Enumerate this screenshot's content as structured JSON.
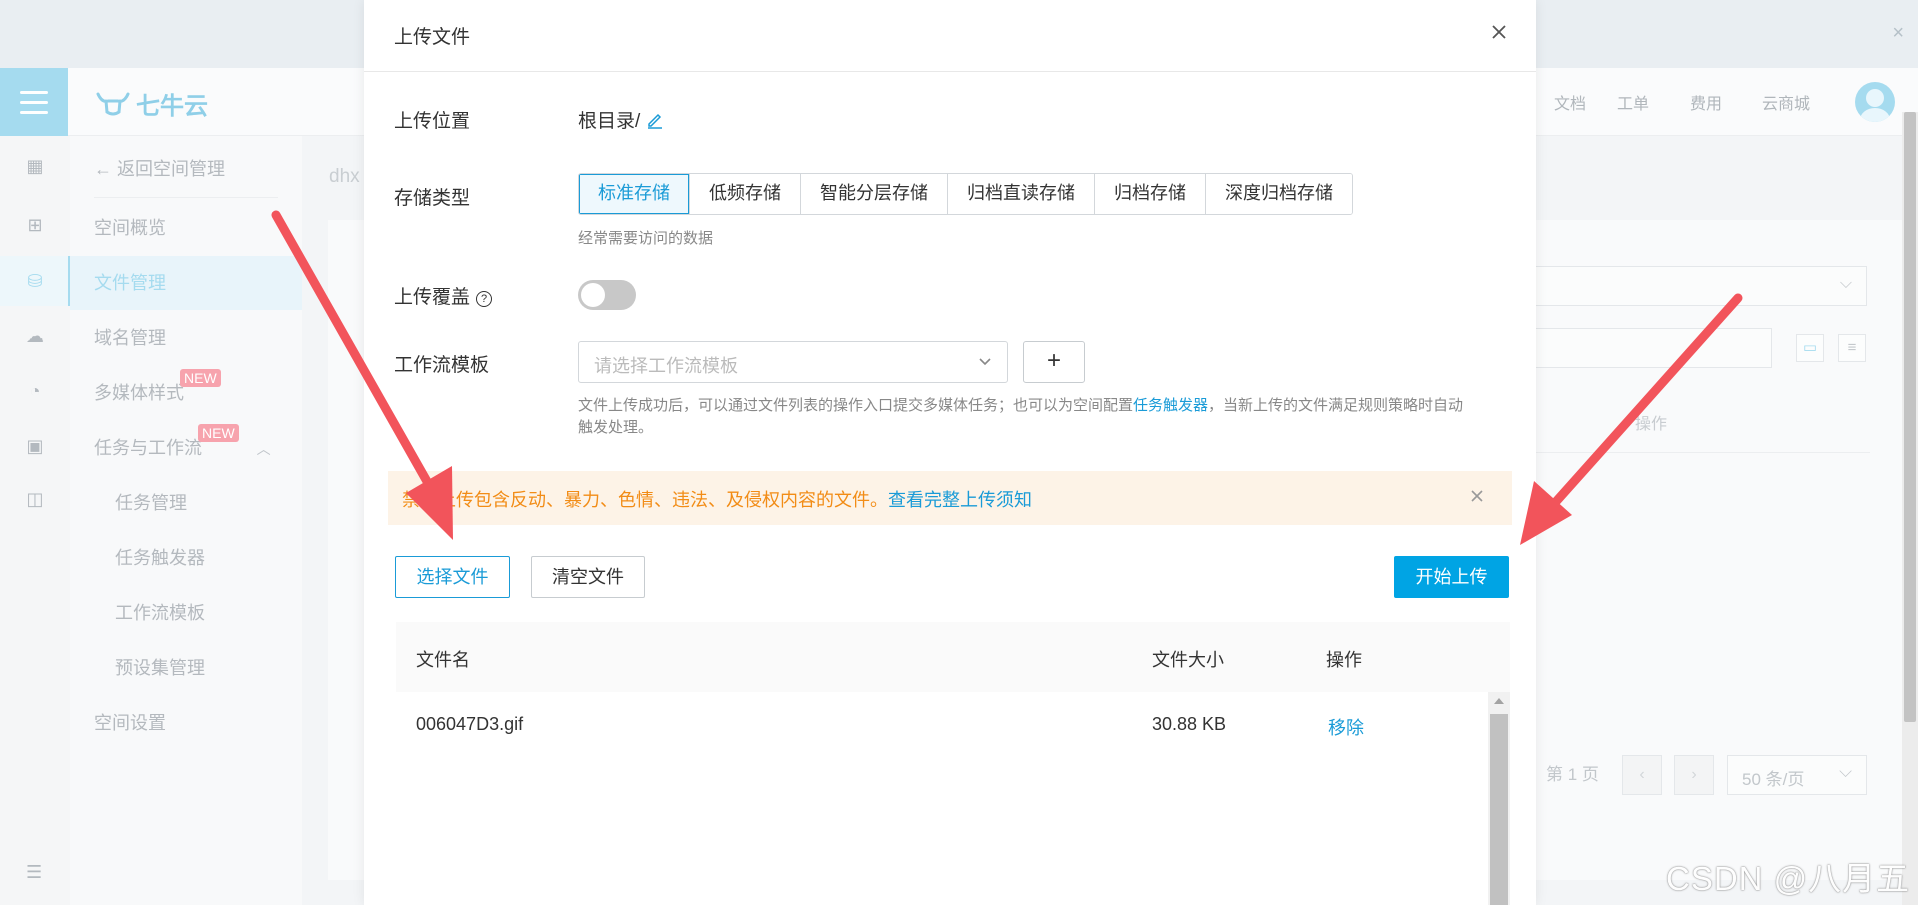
{
  "background": {
    "logo_text": "七牛云",
    "topnav": [
      "文档",
      "工单",
      "费用",
      "云商城"
    ],
    "sidebar": {
      "back_label": "返回空间管理",
      "items": [
        {
          "label": "空间概览"
        },
        {
          "label": "文件管理",
          "active": true
        },
        {
          "label": "域名管理"
        },
        {
          "label": "多媒体样式",
          "badge": "NEW"
        },
        {
          "label": "任务与工作流",
          "badge": "NEW"
        },
        {
          "label": "任务管理",
          "sub": true
        },
        {
          "label": "任务触发器",
          "sub": true
        },
        {
          "label": "工作流模板",
          "sub": true
        },
        {
          "label": "预设集管理",
          "sub": true
        },
        {
          "label": "空间设置"
        }
      ]
    },
    "breadcrumb_text": "dhx",
    "table_op_header": "操作",
    "pager": {
      "page_label": "第 1 页",
      "page_size": "50 条/页"
    }
  },
  "dialog": {
    "title": "上传文件",
    "upload_location_label": "上传位置",
    "upload_location_value": "根目录/",
    "storage_type_label": "存储类型",
    "storage_types": [
      "标准存储",
      "低频存储",
      "智能分层存储",
      "归档直读存储",
      "归档存储",
      "深度归档存储"
    ],
    "storage_selected": "标准存储",
    "storage_hint": "经常需要访问的数据",
    "overwrite_label": "上传覆盖",
    "overwrite_enabled": false,
    "workflow_label": "工作流模板",
    "workflow_placeholder": "请选择工作流模板",
    "workflow_hint_part1": "文件上传成功后，可以通过文件列表的操作入口提交多媒体任务；也可以为空间配置",
    "workflow_hint_link": "任务触发器",
    "workflow_hint_part2": "，当新上传的文件满足规则策略时自动",
    "workflow_hint_line2": "触发处理。",
    "alert_text": "禁止上传包含反动、暴力、色情、违法、及侵权内容的文件。",
    "alert_link": "查看完整上传须知",
    "select_files_label": "选择文件",
    "clear_files_label": "清空文件",
    "start_upload_label": "开始上传",
    "table_headers": {
      "name": "文件名",
      "size": "文件大小",
      "action": "操作"
    },
    "files": [
      {
        "name": "006047D3.gif",
        "size": "30.88 KB",
        "action": "移除"
      }
    ]
  },
  "watermark": "CSDN @八月五",
  "colors": {
    "accent": "#1a9bd7",
    "primary_button": "#00a4e4",
    "alert_bg": "#fdf3e7",
    "alert_text": "#f28c16",
    "arrow": "#f2545b"
  }
}
